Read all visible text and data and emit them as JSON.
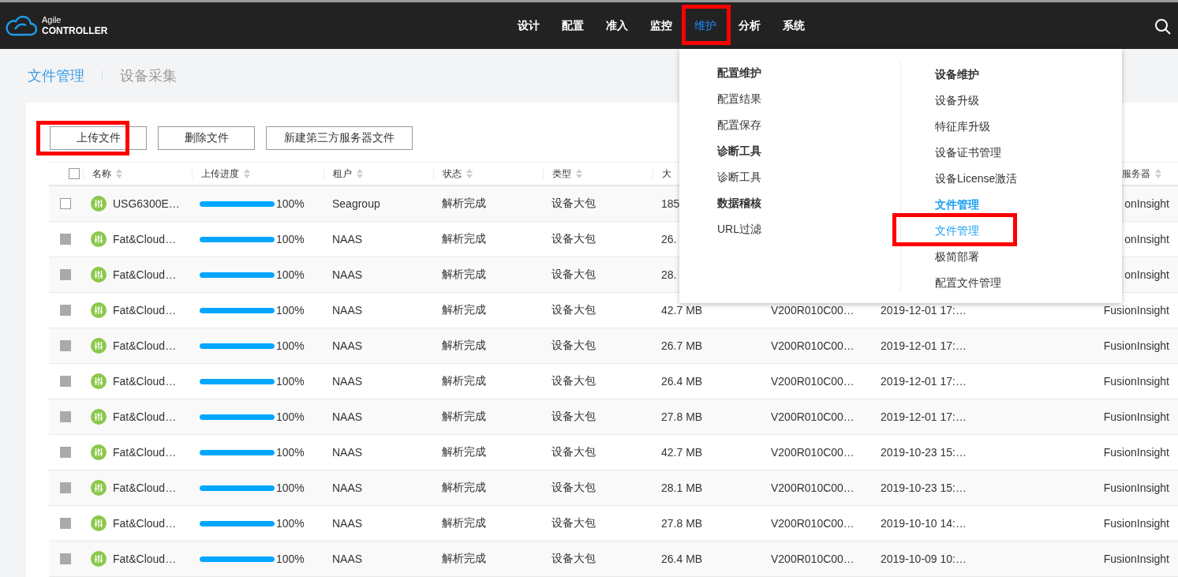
{
  "logo": {
    "line_1": "Agile",
    "line_2": "CONTROLLER"
  },
  "nav": [
    {
      "label": "设计",
      "selected": false,
      "highlighted": false
    },
    {
      "label": "配置",
      "selected": false,
      "highlighted": false
    },
    {
      "label": "准入",
      "selected": false,
      "highlighted": false
    },
    {
      "label": "监控",
      "selected": false,
      "highlighted": false
    },
    {
      "label": "维护",
      "selected": true,
      "highlighted": true
    },
    {
      "label": "分析",
      "selected": false,
      "highlighted": false
    },
    {
      "label": "系统",
      "selected": false,
      "highlighted": false
    }
  ],
  "tabs": [
    {
      "label": "文件管理",
      "selected": true
    },
    {
      "label": "设备采集",
      "selected": false
    }
  ],
  "buttons": [
    {
      "label": "上传文件",
      "highlighted": true
    },
    {
      "label": "删除文件",
      "highlighted": false
    },
    {
      "label": "新建第三方服务器文件",
      "highlighted": false
    }
  ],
  "table": {
    "header_checkbox": {
      "checked": false
    },
    "columns": [
      {
        "label": "名称"
      },
      {
        "label": "上传进度"
      },
      {
        "label": "租户"
      },
      {
        "label": "状态"
      },
      {
        "label": "类型"
      },
      {
        "label": "大"
      },
      {
        "label": "服务器"
      }
    ],
    "rows": [
      {
        "disabled": false,
        "name": "USG6300E…",
        "level": 1,
        "progress": "100%",
        "tenant": "Seagroup",
        "status": "解析完成",
        "type": "设备大包",
        "size": "185",
        "server": "onInsight"
      },
      {
        "disabled": true,
        "name": "Fat&Cloud…",
        "level": 1,
        "progress": "100%",
        "tenant": "NAAS",
        "status": "解析完成",
        "type": "设备大包",
        "size": "26.",
        "server": "onInsight"
      },
      {
        "disabled": true,
        "name": "Fat&Cloud…",
        "level": 1,
        "progress": "100%",
        "tenant": "NAAS",
        "status": "解析完成",
        "type": "设备大包",
        "size": "28.",
        "server": "onInsight"
      },
      {
        "disabled": true,
        "name": "Fat&Cloud…",
        "level": 1,
        "progress": "100%",
        "tenant": "NAAS",
        "status": "解析完成",
        "type": "设备大包",
        "size": "42.7 MB",
        "version": "V200R010C00…",
        "time": "2019-12-01 17:…",
        "server": "FusionInsight"
      },
      {
        "disabled": true,
        "name": "Fat&Cloud…",
        "level": 1,
        "progress": "100%",
        "tenant": "NAAS",
        "status": "解析完成",
        "type": "设备大包",
        "size": "26.7 MB",
        "version": "V200R010C00…",
        "time": "2019-12-01 17:…",
        "server": "FusionInsight"
      },
      {
        "disabled": true,
        "name": "Fat&Cloud…",
        "level": 1,
        "progress": "100%",
        "tenant": "NAAS",
        "status": "解析完成",
        "type": "设备大包",
        "size": "26.4 MB",
        "version": "V200R010C00…",
        "time": "2019-12-01 17:…",
        "server": "FusionInsight"
      },
      {
        "disabled": true,
        "name": "Fat&Cloud…",
        "level": 1,
        "progress": "100%",
        "tenant": "NAAS",
        "status": "解析完成",
        "type": "设备大包",
        "size": "27.8 MB",
        "version": "V200R010C00…",
        "time": "2019-12-01 17:…",
        "server": "FusionInsight"
      },
      {
        "disabled": true,
        "name": "Fat&Cloud…",
        "level": 1,
        "progress": "100%",
        "tenant": "NAAS",
        "status": "解析完成",
        "type": "设备大包",
        "size": "42.7 MB",
        "version": "V200R010C00…",
        "time": "2019-10-23 15:…",
        "server": "FusionInsight"
      },
      {
        "disabled": true,
        "name": "Fat&Cloud…",
        "level": 1,
        "progress": "100%",
        "tenant": "NAAS",
        "status": "解析完成",
        "type": "设备大包",
        "size": "28.1 MB",
        "version": "V200R010C00…",
        "time": "2019-10-23 15:…",
        "server": "FusionInsight"
      },
      {
        "disabled": true,
        "name": "Fat&Cloud…",
        "level": 1,
        "progress": "100%",
        "tenant": "NAAS",
        "status": "解析完成",
        "type": "设备大包",
        "size": "27.8 MB",
        "version": "V200R010C00…",
        "time": "2019-10-10 14:…",
        "server": "FusionInsight"
      },
      {
        "disabled": true,
        "name": "Fat&Cloud…",
        "level": 1,
        "progress": "100%",
        "tenant": "NAAS",
        "status": "解析完成",
        "type": "设备大包",
        "size": "26.4 MB",
        "version": "V200R010C00…",
        "time": "2019-10-09 10:…",
        "server": "FusionInsight"
      }
    ]
  },
  "dropdown": {
    "columns": [
      {
        "entries": [
          {
            "kind": "heading",
            "label": "配置维护",
            "selected": false,
            "highlighted": false
          },
          {
            "kind": "item",
            "label": "配置结果",
            "selected": false,
            "highlighted": false
          },
          {
            "kind": "item",
            "label": "配置保存",
            "selected": false,
            "highlighted": false
          },
          {
            "kind": "heading",
            "label": "诊断工具",
            "selected": false,
            "highlighted": false
          },
          {
            "kind": "item",
            "label": "诊断工具",
            "selected": false,
            "highlighted": false
          },
          {
            "kind": "heading",
            "label": "数据稽核",
            "selected": false,
            "highlighted": false
          },
          {
            "kind": "item",
            "label": "URL过滤",
            "selected": false,
            "highlighted": false
          }
        ]
      },
      {
        "entries": [
          {
            "kind": "heading",
            "label": "设备维护",
            "selected": false,
            "highlighted": false
          },
          {
            "kind": "item",
            "label": "设备升级",
            "selected": false,
            "highlighted": false
          },
          {
            "kind": "item",
            "label": "特征库升级",
            "selected": false,
            "highlighted": false
          },
          {
            "kind": "item",
            "label": "设备证书管理",
            "selected": false,
            "highlighted": false
          },
          {
            "kind": "item",
            "label": "设备License激活",
            "selected": false,
            "highlighted": false
          },
          {
            "kind": "heading",
            "label": "文件管理",
            "selected": true,
            "highlighted": false
          },
          {
            "kind": "item",
            "label": "文件管理",
            "selected": true,
            "highlighted": true
          },
          {
            "kind": "item",
            "label": "极简部署",
            "selected": false,
            "highlighted": false
          },
          {
            "kind": "item",
            "label": "配置文件管理",
            "selected": false,
            "highlighted": false
          }
        ]
      }
    ]
  }
}
